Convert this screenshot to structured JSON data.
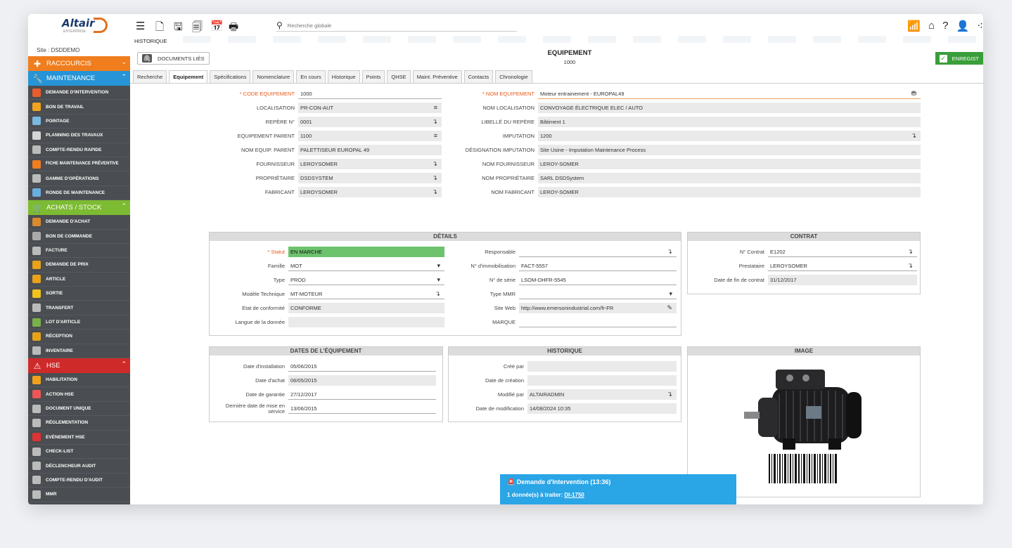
{
  "app": {
    "logo": "Altair",
    "logo_sub": "ENTERPRISE",
    "site": "Site : DSDDEMO"
  },
  "sidebar": {
    "raccourcis": "RACCOURCIS",
    "maintenance": "MAINTENANCE",
    "maintenance_items": [
      "DEMANDE D'INTERVENTION",
      "BON DE TRAVAIL",
      "POINTAGE",
      "PLANNING DES TRAVAUX",
      "COMPTE-RENDU RAPIDE",
      "FICHE MAINTENANCE PRÉVENTIVE",
      "GAMME D'OPÉRATIONS",
      "RONDE DE MAINTENANCE"
    ],
    "achats": "ACHATS / STOCK",
    "achats_items": [
      "DEMANDE D'ACHAT",
      "BON DE COMMANDE",
      "FACTURE",
      "DEMANDE DE PRIX",
      "ARTICLE",
      "SORTIE",
      "TRANSFERT",
      "LOT D'ARTICLE",
      "RÉCEPTION",
      "INVENTAIRE"
    ],
    "hse": "HSE",
    "hse_items": [
      "HABILITATION",
      "ACTION HSE",
      "DOCUMENT UNIQUE",
      "RÉGLEMENTATION",
      "EVÈNEMENT HSE",
      "CHECK-LIST",
      "DÉCLENCHEUR AUDIT",
      "COMPTE-RENDU D'AUDIT",
      "MMR"
    ]
  },
  "topbar": {
    "search_placeholder": "Recherche globale",
    "historique": "HISTORIQUE"
  },
  "header": {
    "docs_button": "DOCUMENTS LIÉS",
    "title": "EQUIPEMENT",
    "subtitle": "1000",
    "save": "ENREGIST"
  },
  "tabs": [
    "Recherche",
    "Equipement",
    "Spécifications",
    "Nomenclature",
    "En cours",
    "Historique",
    "Points",
    "QHSE",
    "Maint. Préventive",
    "Contacts",
    "Chronologie"
  ],
  "left_fields": [
    {
      "label": "* CODE EQUIPEMENT",
      "value": "1000"
    },
    {
      "label": "LOCALISATION",
      "value": "PR-CON-AUT"
    },
    {
      "label": "REPÈRE N°",
      "value": "0001"
    },
    {
      "label": "EQUIPEMENT PARENT",
      "value": "1100"
    },
    {
      "label": "NOM EQUIP. PARENT",
      "value": "PALETTISEUR EUROPAL 49"
    },
    {
      "label": "FOURNISSEUR",
      "value": "LEROYSOMER"
    },
    {
      "label": "PROPRIÉTAIRE",
      "value": "DSDSYSTEM"
    },
    {
      "label": "FABRICANT",
      "value": "LEROYSOMER"
    }
  ],
  "right_fields": [
    {
      "label": "* NOM EQUIPEMENT",
      "value": "Moteur entrainement - EUROPAL49"
    },
    {
      "label": "NOM LOCALISATION",
      "value": "CONVOYAGE ÉLECTRIQUE ELEC / AUTO"
    },
    {
      "label": "LIBELLÉ DU REPÈRE",
      "value": "Bâtiment 1"
    },
    {
      "label": "IMPUTATION",
      "value": "1200"
    },
    {
      "label": "DÉSIGNATION IMPUTATION",
      "value": "Site Usine - Imputation Maintenance Process"
    },
    {
      "label": "NOM FOURNISSEUR",
      "value": "LEROY-SOMER"
    },
    {
      "label": "NOM PROPRIÉTAIRE",
      "value": "SARL DSDSystem"
    },
    {
      "label": "NOM FABRICANT",
      "value": "LEROY-SOMER"
    }
  ],
  "details": {
    "title": "DÉTAILS",
    "left": [
      {
        "label": "* Statut",
        "value": "EN MARCHE"
      },
      {
        "label": "Famille",
        "value": "MOT"
      },
      {
        "label": "Type",
        "value": "PROD"
      },
      {
        "label": "Modèle Technique",
        "value": "MT-MOTEUR"
      },
      {
        "label": "Etat de conformité",
        "value": "CONFORME"
      },
      {
        "label": "Langue de la donnée",
        "value": ""
      }
    ],
    "right": [
      {
        "label": "Responsable",
        "value": ""
      },
      {
        "label": "N° d'immobilisation",
        "value": "FACT-5557"
      },
      {
        "label": "N° de série",
        "value": "LSOM-DHFR-5545"
      },
      {
        "label": "Type MMR",
        "value": ""
      },
      {
        "label": "Site Web",
        "value": "http://www.emersonindustrial.com/fr-FR"
      },
      {
        "label": "MARQUE",
        "value": ""
      }
    ]
  },
  "contrat": {
    "title": "CONTRAT",
    "fields": [
      {
        "label": "N° Contrat",
        "value": "E1202"
      },
      {
        "label": "Prestataire",
        "value": "LEROYSOMER"
      },
      {
        "label": "Date de fin de contrat",
        "value": "31/12/2017"
      }
    ]
  },
  "dates": {
    "title": "DATES DE L'ÉQUIPEMENT",
    "fields": [
      {
        "label": "Date d'installation",
        "value": "05/06/2015"
      },
      {
        "label": "Date d'achat",
        "value": "06/05/2015"
      },
      {
        "label": "Date de garantie",
        "value": "27/12/2017"
      },
      {
        "label": "Dernière date de mise en service",
        "value": "13/06/2015"
      }
    ]
  },
  "historique": {
    "title": "HISTORIQUE",
    "fields": [
      {
        "label": "Créé par",
        "value": ""
      },
      {
        "label": "Date de création",
        "value": ""
      },
      {
        "label": "Modifié par",
        "value": "ALTAIRADMIN"
      },
      {
        "label": "Date de modification",
        "value": "14/08/2024 10:35"
      }
    ]
  },
  "image": {
    "title": "IMAGE"
  },
  "notification": {
    "title": "Demande d'Intervention (13:36)",
    "text": "1 donnée(s) à traiter:",
    "link": "DI-1750"
  }
}
